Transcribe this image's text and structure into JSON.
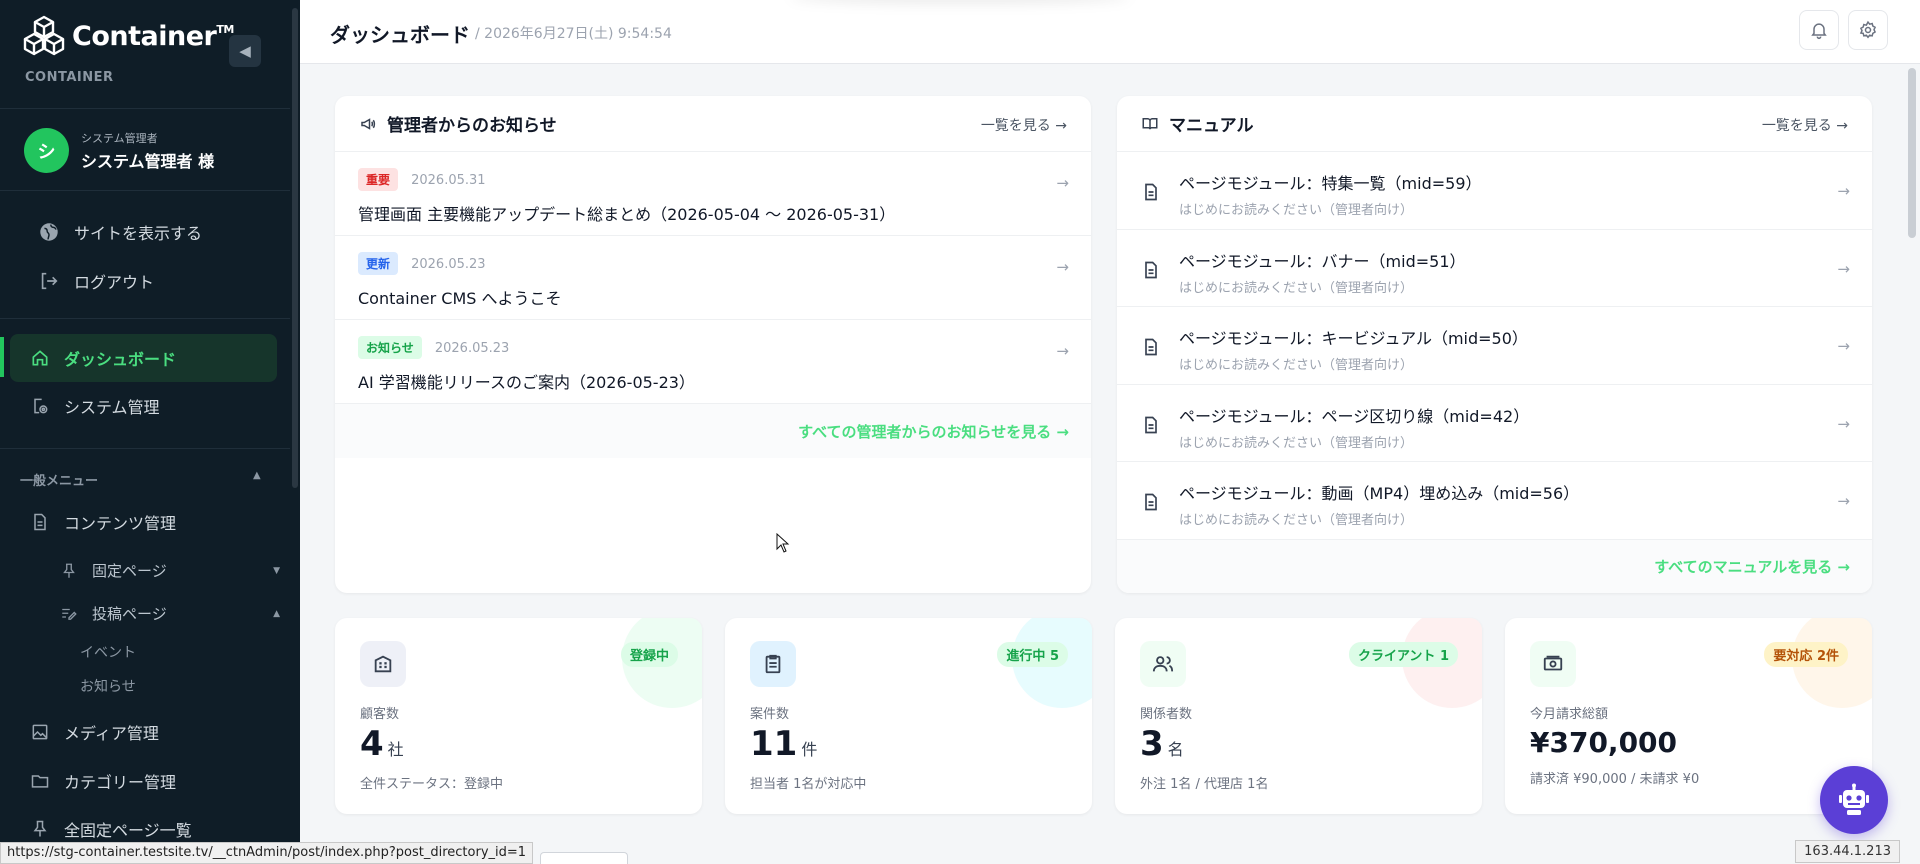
{
  "brand": {
    "name": "Container",
    "tm": "TM",
    "sub": "CONTAINER"
  },
  "user": {
    "initial": "シ",
    "role": "システム管理者",
    "name": "システム管理者 様"
  },
  "sidebar": {
    "links": [
      {
        "label": "サイトを表示する",
        "icon": "globe-icon"
      },
      {
        "label": "ログアウト",
        "icon": "logout-icon"
      }
    ],
    "nav": [
      {
        "label": "ダッシュボード",
        "icon": "home-icon",
        "active": true
      },
      {
        "label": "システム管理",
        "icon": "system-icon",
        "active": false
      }
    ],
    "section_label": "一般メニュー",
    "menu": [
      {
        "label": "コンテンツ管理",
        "icon": "document-icon"
      },
      {
        "label": "固定ページ",
        "icon": "pin-icon"
      },
      {
        "label": "投稿ページ",
        "icon": "edit-list-icon"
      },
      {
        "label": "イベント"
      },
      {
        "label": "お知らせ"
      },
      {
        "label": "メディア管理",
        "icon": "image-icon"
      },
      {
        "label": "カテゴリー管理",
        "icon": "folder-icon"
      },
      {
        "label": "全固定ページ一覧",
        "icon": "pin-icon"
      }
    ]
  },
  "header": {
    "title": "ダッシュボード",
    "date": "/ 2026年6月27日(土) 9:54:54"
  },
  "announcements": {
    "title": "管理者からのお知らせ",
    "view_all": "一覧を見る",
    "items": [
      {
        "badge": "重要",
        "date": "2026.05.31",
        "title": "管理画面 主要機能アップデート総まとめ（2026-05-04 〜 2026-05-31）"
      },
      {
        "badge": "更新",
        "date": "2026.05.23",
        "title": "Container CMS へようこそ"
      },
      {
        "badge": "お知らせ",
        "date": "2026.05.23",
        "title": "AI 学習機能リリースのご案内（2026-05-23）"
      }
    ],
    "footer": "すべての管理者からのお知らせを見る →"
  },
  "manual": {
    "title": "マニュアル",
    "view_all": "一覧を見る",
    "items": [
      {
        "title": "ページモジュール：特集一覧（mid=59）",
        "sub": "はじめにお読みください（管理者向け）"
      },
      {
        "title": "ページモジュール：バナー（mid=51）",
        "sub": "はじめにお読みください（管理者向け）"
      },
      {
        "title": "ページモジュール：キービジュアル（mid=50）",
        "sub": "はじめにお読みください（管理者向け）"
      },
      {
        "title": "ページモジュール：ページ区切り線（mid=42）",
        "sub": "はじめにお読みください（管理者向け）"
      },
      {
        "title": "ページモジュール：動画（MP4）埋め込み（mid=56）",
        "sub": "はじめにお読みください（管理者向け）"
      }
    ],
    "footer": "すべてのマニュアルを見る →"
  },
  "stats": [
    {
      "label": "顧客数",
      "value": "4",
      "unit": "社",
      "badge": "登録中",
      "note": "全件ステータス：登録中",
      "color": "#22c55e"
    },
    {
      "label": "案件数",
      "value": "11",
      "unit": "件",
      "badge": "進行中 5",
      "note": "担当者 1名が対応中",
      "color": "#0ea5b7"
    },
    {
      "label": "関係者数",
      "value": "3",
      "unit": "名",
      "badge": "クライアント 1",
      "note": "外注 1名 / 代理店 1名",
      "color": "#16a34a"
    },
    {
      "label": "今月請求総額",
      "value": "¥370,000",
      "unit": "",
      "badge": "要対応 2件",
      "note": "請求済 ¥90,000 / 未請求 ¥0",
      "color": "#d97706"
    }
  ],
  "status_url": "https://stg-container.testsite.tv/__ctnAdmin/post/index.php?post_directory_id=1",
  "ip": "163.44.1.213"
}
